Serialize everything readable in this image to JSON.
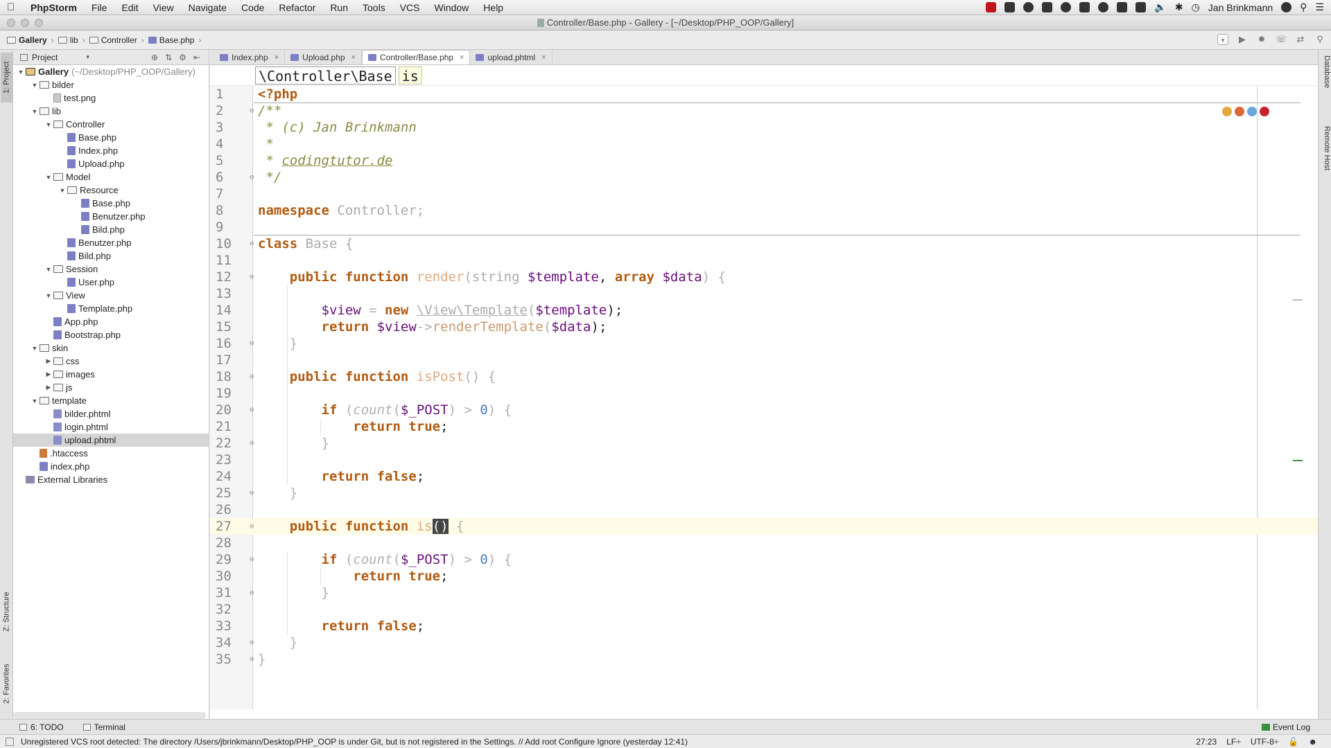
{
  "menubar": {
    "app": "PhpStorm",
    "items": [
      "File",
      "Edit",
      "View",
      "Navigate",
      "Code",
      "Refactor",
      "Run",
      "Tools",
      "VCS",
      "Window",
      "Help"
    ],
    "user": "Jan Brinkmann"
  },
  "window": {
    "title": "Controller/Base.php - Gallery - [~/Desktop/PHP_OOP/Gallery]"
  },
  "navbar": {
    "crumbs": [
      "Gallery",
      "lib",
      "Controller",
      "Base.php"
    ]
  },
  "project_panel": {
    "selector": "Project",
    "tree": [
      {
        "label": "Gallery",
        "path": "(~/Desktop/PHP_OOP/Gallery)",
        "depth": 0,
        "type": "root",
        "open": true
      },
      {
        "label": "bilder",
        "depth": 1,
        "type": "folder",
        "open": true
      },
      {
        "label": "test.png",
        "depth": 2,
        "type": "png"
      },
      {
        "label": "lib",
        "depth": 1,
        "type": "folder",
        "open": true
      },
      {
        "label": "Controller",
        "depth": 2,
        "type": "folder",
        "open": true
      },
      {
        "label": "Base.php",
        "depth": 3,
        "type": "php"
      },
      {
        "label": "Index.php",
        "depth": 3,
        "type": "php"
      },
      {
        "label": "Upload.php",
        "depth": 3,
        "type": "php"
      },
      {
        "label": "Model",
        "depth": 2,
        "type": "folder",
        "open": true
      },
      {
        "label": "Resource",
        "depth": 3,
        "type": "folder",
        "open": true
      },
      {
        "label": "Base.php",
        "depth": 4,
        "type": "php"
      },
      {
        "label": "Benutzer.php",
        "depth": 4,
        "type": "php"
      },
      {
        "label": "Bild.php",
        "depth": 4,
        "type": "php"
      },
      {
        "label": "Benutzer.php",
        "depth": 3,
        "type": "php"
      },
      {
        "label": "Bild.php",
        "depth": 3,
        "type": "php"
      },
      {
        "label": "Session",
        "depth": 2,
        "type": "folder",
        "open": true
      },
      {
        "label": "User.php",
        "depth": 3,
        "type": "php"
      },
      {
        "label": "View",
        "depth": 2,
        "type": "folder",
        "open": true
      },
      {
        "label": "Template.php",
        "depth": 3,
        "type": "php"
      },
      {
        "label": "App.php",
        "depth": 2,
        "type": "php"
      },
      {
        "label": "Bootstrap.php",
        "depth": 2,
        "type": "php"
      },
      {
        "label": "skin",
        "depth": 1,
        "type": "folder",
        "open": true
      },
      {
        "label": "css",
        "depth": 2,
        "type": "folder",
        "open": false
      },
      {
        "label": "images",
        "depth": 2,
        "type": "folder",
        "open": false
      },
      {
        "label": "js",
        "depth": 2,
        "type": "folder",
        "open": false
      },
      {
        "label": "template",
        "depth": 1,
        "type": "folder",
        "open": true
      },
      {
        "label": "bilder.phtml",
        "depth": 2,
        "type": "phtml"
      },
      {
        "label": "login.phtml",
        "depth": 2,
        "type": "phtml"
      },
      {
        "label": "upload.phtml",
        "depth": 2,
        "type": "phtml",
        "selected": true
      },
      {
        "label": ".htaccess",
        "depth": 1,
        "type": "ht"
      },
      {
        "label": "index.php",
        "depth": 1,
        "type": "php"
      },
      {
        "label": "External Libraries",
        "depth": 0,
        "type": "lib"
      }
    ]
  },
  "side_tabs": {
    "project": "1: Project",
    "structure": "Z: Structure",
    "favorites": "2: Favorites",
    "database": "Database",
    "remote": "Remote Host"
  },
  "editor": {
    "tabs": [
      {
        "label": "Index.php",
        "active": false
      },
      {
        "label": "Upload.php",
        "active": false
      },
      {
        "label": "Controller/Base.php",
        "active": true
      },
      {
        "label": "upload.phtml",
        "active": false
      }
    ],
    "breadcrumb": [
      "\\Controller\\Base",
      "is"
    ],
    "current_line": 27
  },
  "code_lines": [
    [
      [
        "tag",
        "<?php"
      ]
    ],
    [
      [
        "cm",
        "/**"
      ]
    ],
    [
      [
        "cm",
        " * (c) Jan Brinkmann"
      ]
    ],
    [
      [
        "cm",
        " *"
      ]
    ],
    [
      [
        "cm",
        " * "
      ],
      [
        "cm-link",
        "codingtutor.de"
      ]
    ],
    [
      [
        "cm",
        " */"
      ]
    ],
    [],
    [
      [
        "kw",
        "namespace "
      ],
      [
        "ns",
        "Controller;"
      ]
    ],
    [],
    [
      [
        "kw",
        "class "
      ],
      [
        "ns",
        "Base {"
      ]
    ],
    [],
    [
      [
        "plain",
        "    "
      ],
      [
        "kw",
        "public function "
      ],
      [
        "fn",
        "render"
      ],
      [
        "dim",
        "("
      ],
      [
        "ns",
        "string "
      ],
      [
        "var",
        "$template"
      ],
      [
        "dark",
        ", "
      ],
      [
        "kw",
        "array "
      ],
      [
        "var",
        "$data"
      ],
      [
        "dim",
        ") {"
      ]
    ],
    [],
    [
      [
        "plain",
        "        "
      ],
      [
        "var",
        "$view"
      ],
      [
        "dim",
        " = "
      ],
      [
        "kw",
        "new "
      ],
      [
        "dim-ul",
        "\\View\\Template"
      ],
      [
        "dim",
        "("
      ],
      [
        "var",
        "$template"
      ],
      [
        "dark",
        ");"
      ]
    ],
    [
      [
        "plain",
        "        "
      ],
      [
        "kw",
        "return "
      ],
      [
        "var",
        "$view"
      ],
      [
        "dim",
        "->"
      ],
      [
        "fnu",
        "renderTemplate"
      ],
      [
        "dim",
        "("
      ],
      [
        "var",
        "$data"
      ],
      [
        "dark",
        ");"
      ]
    ],
    [
      [
        "plain",
        "    "
      ],
      [
        "dim",
        "}"
      ]
    ],
    [],
    [
      [
        "plain",
        "    "
      ],
      [
        "kw",
        "public function "
      ],
      [
        "fn",
        "isPost"
      ],
      [
        "dim",
        "() {"
      ]
    ],
    [],
    [
      [
        "plain",
        "        "
      ],
      [
        "kw",
        "if "
      ],
      [
        "dim",
        "("
      ],
      [
        "dim italic",
        "count"
      ],
      [
        "dim",
        "("
      ],
      [
        "var",
        "$_POST"
      ],
      [
        "dim",
        ") > "
      ],
      [
        "num-lit",
        "0"
      ],
      [
        "dim",
        ") {"
      ]
    ],
    [
      [
        "plain",
        "            "
      ],
      [
        "kw",
        "return true"
      ],
      [
        "dark",
        ";"
      ]
    ],
    [
      [
        "plain",
        "        "
      ],
      [
        "dim",
        "}"
      ]
    ],
    [],
    [
      [
        "plain",
        "        "
      ],
      [
        "kw",
        "return false"
      ],
      [
        "dark",
        ";"
      ]
    ],
    [
      [
        "plain",
        "    "
      ],
      [
        "dim",
        "}"
      ]
    ],
    [],
    [
      [
        "plain",
        "    "
      ],
      [
        "kw",
        "public function "
      ],
      [
        "fn",
        "is"
      ],
      [
        "cursor-box",
        "()"
      ],
      [
        "dim",
        " {"
      ]
    ],
    [],
    [
      [
        "plain",
        "        "
      ],
      [
        "kw",
        "if "
      ],
      [
        "dim",
        "("
      ],
      [
        "dim italic",
        "count"
      ],
      [
        "dim",
        "("
      ],
      [
        "var",
        "$_POST"
      ],
      [
        "dim",
        ") > "
      ],
      [
        "num-lit",
        "0"
      ],
      [
        "dim",
        ") {"
      ]
    ],
    [
      [
        "plain",
        "            "
      ],
      [
        "kw",
        "return true"
      ],
      [
        "dark",
        ";"
      ]
    ],
    [
      [
        "plain",
        "        "
      ],
      [
        "dim",
        "}"
      ]
    ],
    [],
    [
      [
        "plain",
        "        "
      ],
      [
        "kw",
        "return false"
      ],
      [
        "dark",
        ";"
      ]
    ],
    [
      [
        "plain",
        "    "
      ],
      [
        "dim",
        "}"
      ]
    ],
    [
      [
        "dim",
        "}"
      ]
    ]
  ],
  "bottom": {
    "todo": "6: TODO",
    "terminal": "Terminal",
    "event_log": "Event Log"
  },
  "status": {
    "message": "Unregistered VCS root detected: The directory /Users/jbrinkmann/Desktop/PHP_OOP is under Git, but is not registered in the Settings. // Add root  Configure  Ignore (yesterday 12:41)",
    "position": "27:23",
    "line_sep": "LF÷",
    "encoding": "UTF-8÷"
  },
  "colors": {
    "keyword": "#b15a0f",
    "variable": "#660e7a",
    "comment": "#8a8a40",
    "number": "#4a7bbf"
  }
}
